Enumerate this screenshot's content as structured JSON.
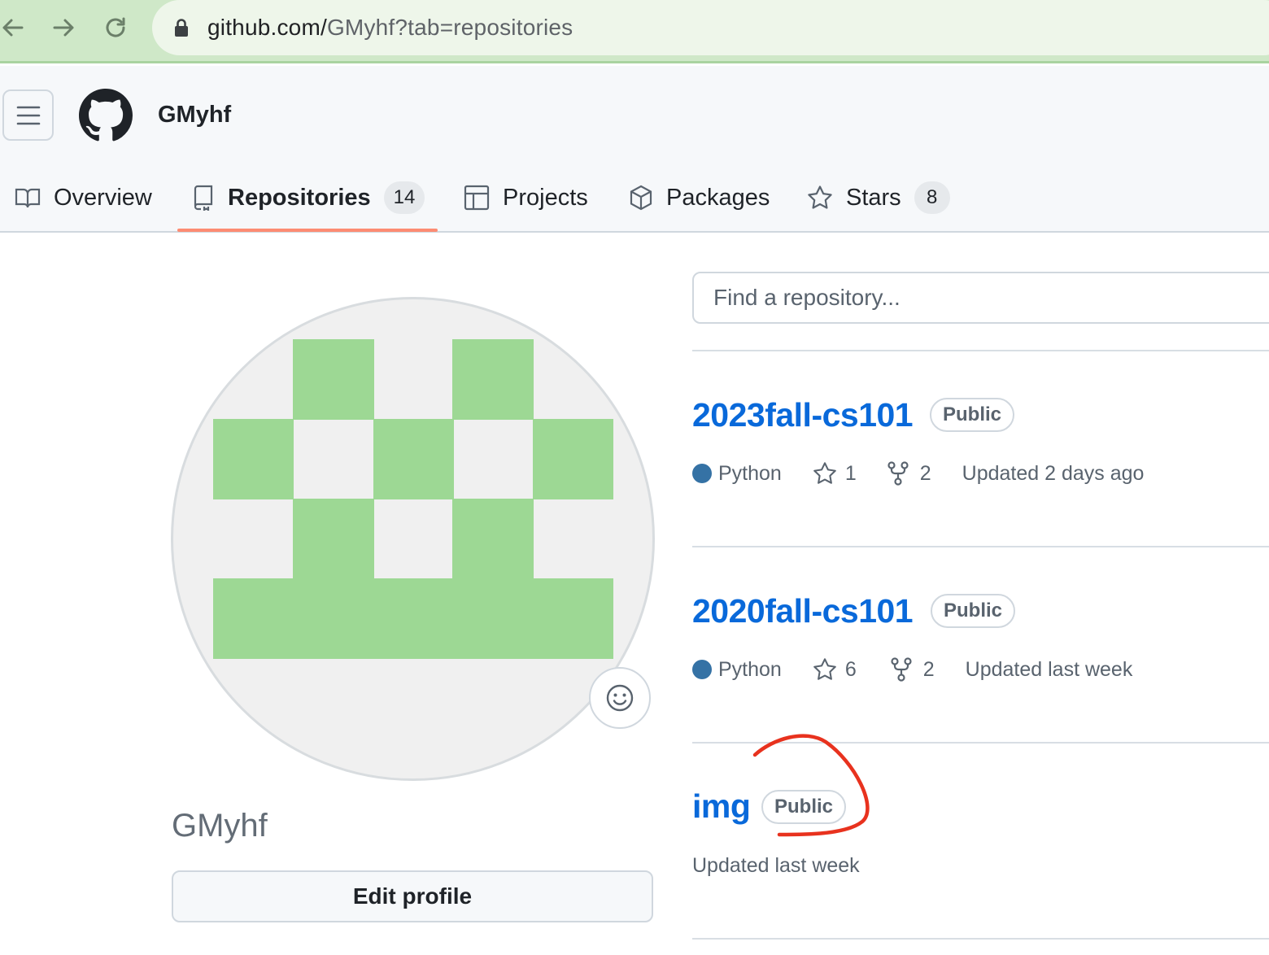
{
  "browser": {
    "url_host": "github.com/",
    "url_path": "GMyhf?tab=repositories"
  },
  "header": {
    "username": "GMyhf"
  },
  "tabs": [
    {
      "label": "Overview",
      "icon": "book-icon"
    },
    {
      "label": "Repositories",
      "count": "14",
      "icon": "repo-icon",
      "active": true
    },
    {
      "label": "Projects",
      "icon": "table-icon"
    },
    {
      "label": "Packages",
      "icon": "package-icon"
    },
    {
      "label": "Stars",
      "count": "8",
      "icon": "star-icon"
    }
  ],
  "profile": {
    "name": "GMyhf",
    "edit_label": "Edit profile",
    "avatar_color": "#9dd894"
  },
  "search": {
    "placeholder": "Find a repository..."
  },
  "repos": [
    {
      "name": "2023fall-cs101",
      "visibility": "Public",
      "language": "Python",
      "language_color": "#3572A5",
      "stars": "1",
      "forks": "2",
      "updated": "Updated 2 days ago"
    },
    {
      "name": "2020fall-cs101",
      "visibility": "Public",
      "language": "Python",
      "language_color": "#3572A5",
      "stars": "6",
      "forks": "2",
      "updated": "Updated last week"
    },
    {
      "name": "img",
      "visibility": "Public",
      "updated": "Updated last week"
    }
  ],
  "colors": {
    "link": "#0969da",
    "tab_underline": "#fd8c73",
    "annotation": "#e8321e"
  }
}
